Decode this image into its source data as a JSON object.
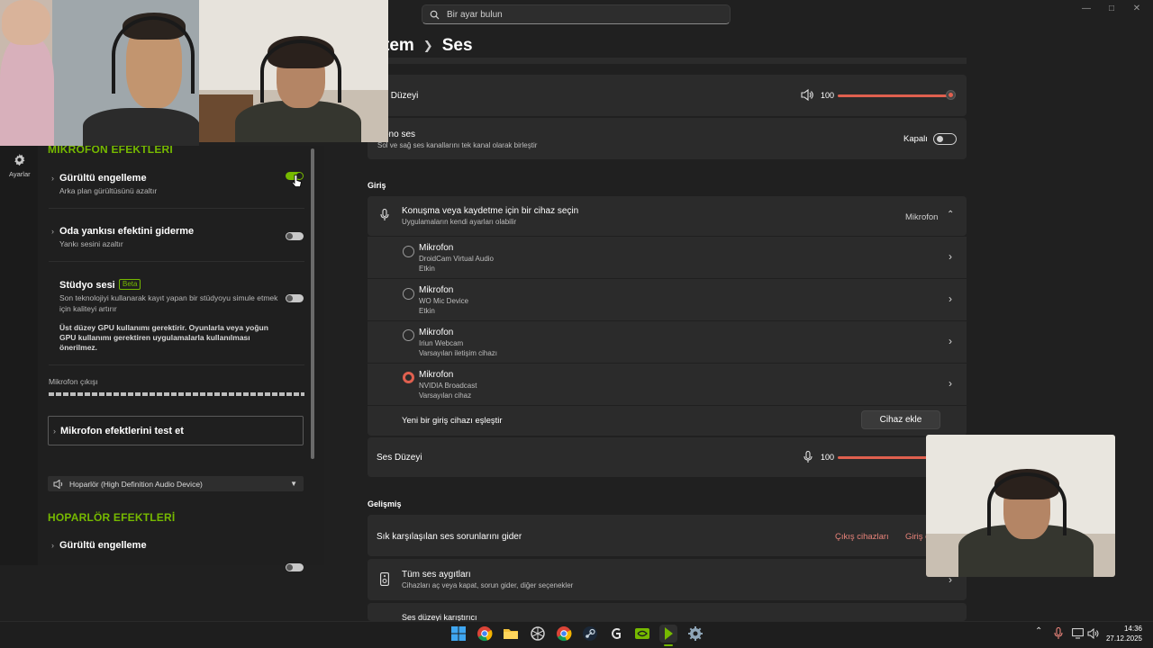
{
  "settings": {
    "search_placeholder": "Bir ayar bulun",
    "breadcrumb": {
      "parent": "tem",
      "current": "Ses"
    },
    "output": {
      "volume_label": "s Düzeyi",
      "volume_value": "100",
      "volume_level": 1.0,
      "mono_title": "ono ses",
      "mono_sub": "Sol ve sağ ses kanallarını tek kanal olarak birleştir",
      "mono_state": "Kapalı"
    },
    "input_section": "Giriş",
    "choose_device": {
      "title": "Konuşma veya kaydetme için bir cihaz seçin",
      "sub": "Uygulamaların kendi ayarları olabilir",
      "selected": "Mikrofon"
    },
    "devices": [
      {
        "name": "Mikrofon",
        "sub1": "DroidCam Virtual Audio",
        "sub2": "Etkin",
        "selected": false
      },
      {
        "name": "Mikrofon",
        "sub1": "WO Mic Device",
        "sub2": "Etkin",
        "selected": false
      },
      {
        "name": "Mikrofon",
        "sub1": "Iriun Webcam",
        "sub2": "Varsayılan iletişim cihazı",
        "selected": false
      },
      {
        "name": "Mikrofon",
        "sub1": "NVIDIA Broadcast",
        "sub2": "Varsayılan cihaz",
        "selected": true
      }
    ],
    "pair_device": {
      "label": "Yeni bir giriş cihazı eşleştir",
      "button": "Cihaz ekle"
    },
    "input_volume": {
      "label": "Ses Düzeyi",
      "value": "100",
      "level": 1.0
    },
    "advanced_section": "Gelişmiş",
    "troubleshoot": {
      "label": "Sık karşılaşılan ses sorunlarını gider",
      "link1": "Çıkış cihazları",
      "link2": "Giriş c"
    },
    "all_devices": {
      "title": "Tüm ses aygıtları",
      "sub": "Cihazları aç veya kapat, sorun gider, diğer seçenekler"
    },
    "mixer_partial": "Ses düzeyi karıştırıcı"
  },
  "nvidia": {
    "rail_label": "Ayarlar",
    "mic_effects_header": "MİKROFON EFEKTLERİ",
    "effects": [
      {
        "title": "Gürültü engelleme",
        "sub": "Arka plan gürültüsünü azaltır",
        "enabled": true
      },
      {
        "title": "Oda yankısı efektini giderme",
        "sub": "Yankı sesini azaltır",
        "enabled": false
      }
    ],
    "studio": {
      "title": "Stüdyo sesi",
      "badge": "Beta",
      "sub": "Son teknolojiyi kullanarak kayıt yapan bir stüdyoyu simule etmek için kaliteyi artırır",
      "warning": "Üst düzey GPU kullanımı gerektirir. Oyunlarla veya yoğun GPU kullanımı gerektiren uygulamalarla kullanılması önerilmez.",
      "enabled": false
    },
    "mic_output_label": "Mikrofon çıkışı",
    "test_label": "Mikrofon efektlerini test et",
    "speaker_device": "Hoparlör (High Definition Audio Device)",
    "speaker_effects_header": "HOPARLÖR EFEKTLERİ",
    "speaker_effect": {
      "title": "Gürültü engelleme",
      "enabled": false
    }
  },
  "taskbar": {
    "time": "14:36",
    "date": "27.12.2025"
  },
  "colors": {
    "accent": "#e0604f",
    "nvidia_green": "#76b900"
  }
}
